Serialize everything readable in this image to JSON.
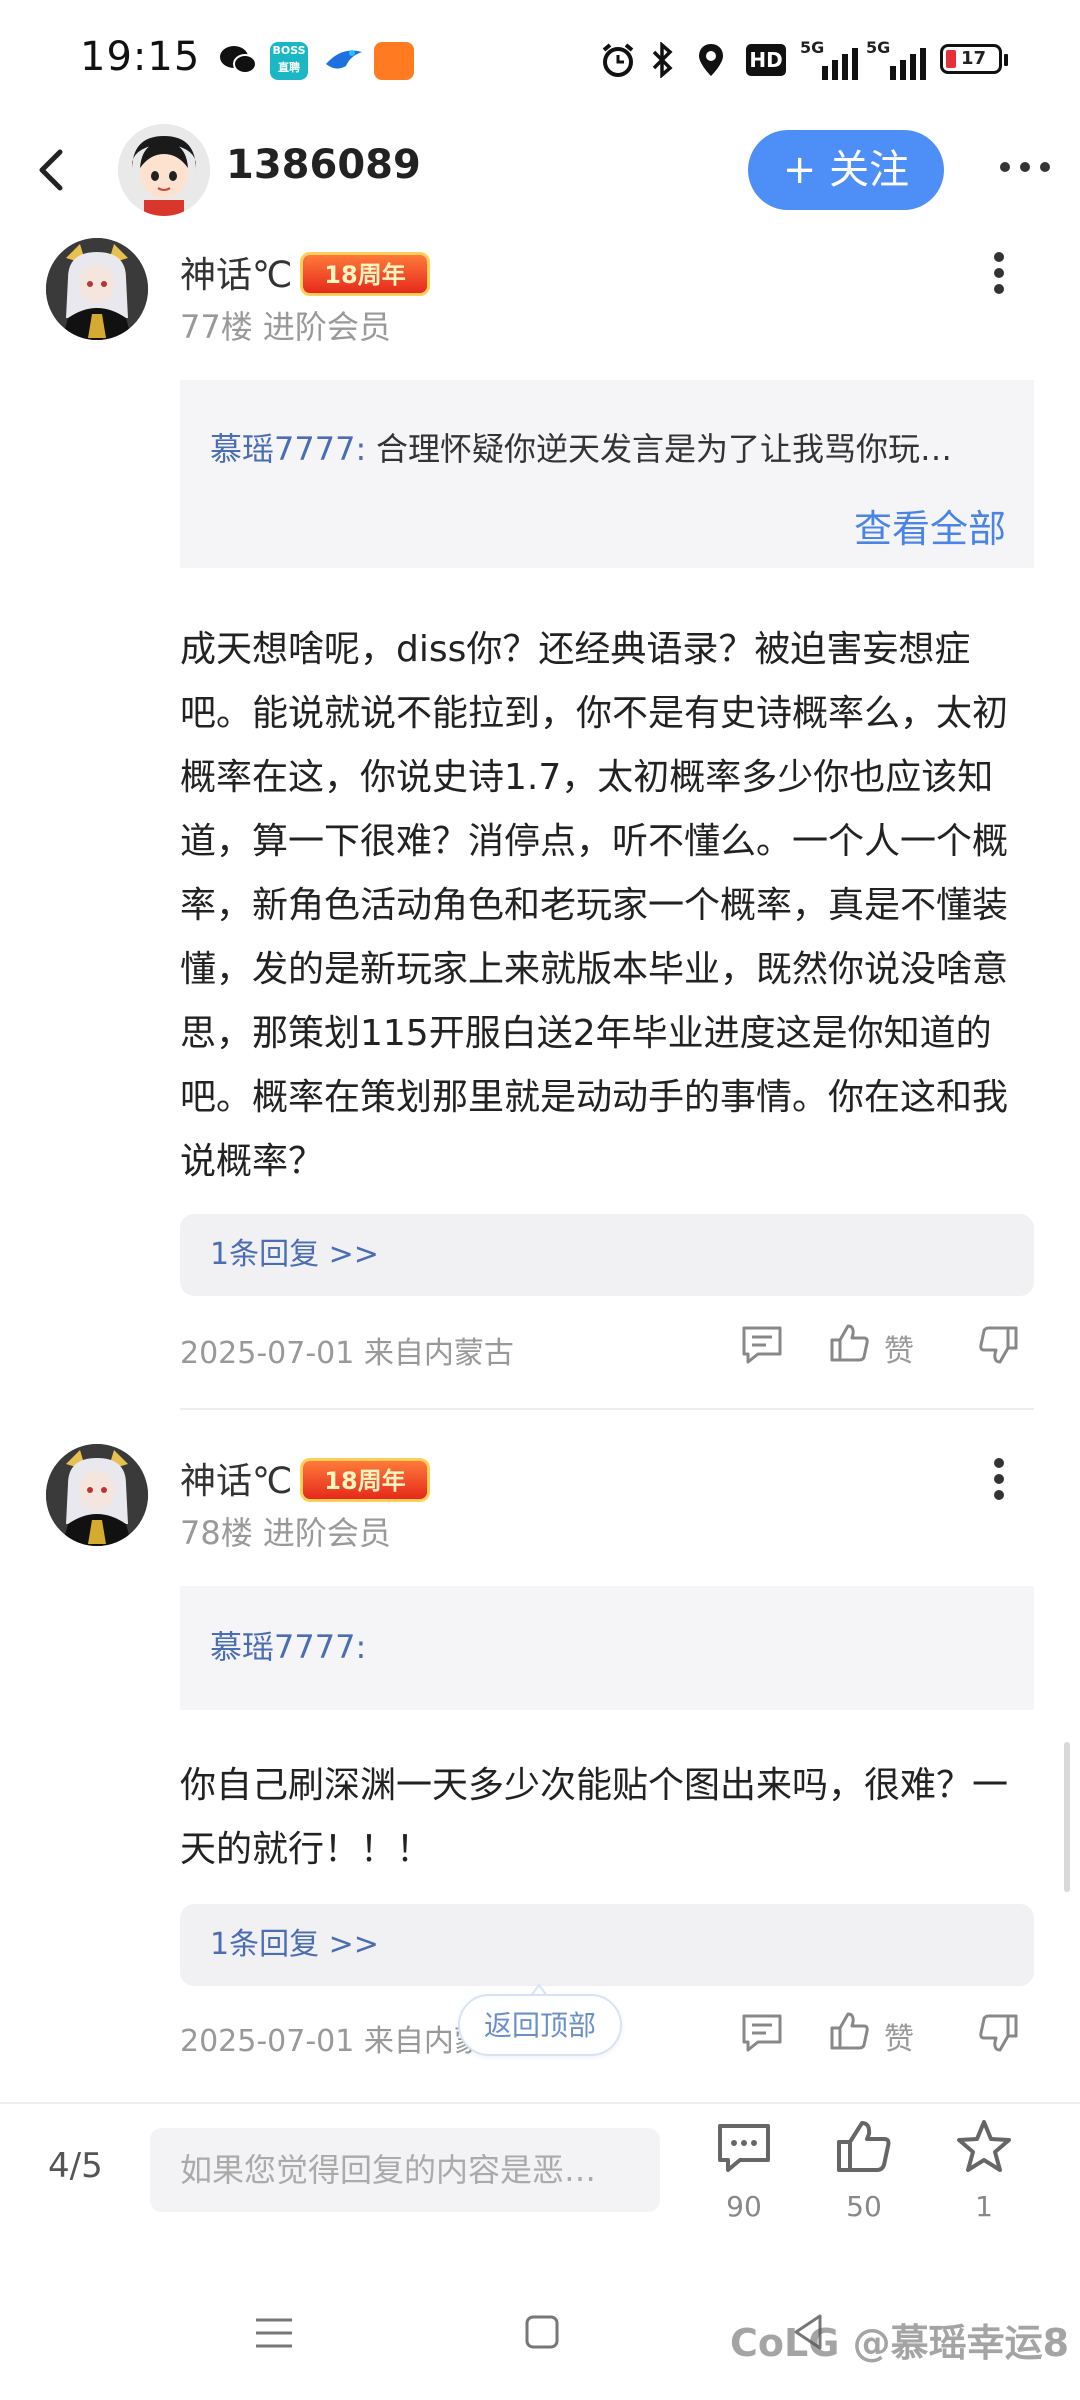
{
  "status_bar": {
    "time": "19:15",
    "battery": "17",
    "app_icons": [
      "chat-bubble-icon",
      "boss-app-icon",
      "bird-app-icon",
      "orange-app-icon"
    ],
    "system_icons": [
      "alarm-icon",
      "bluetooth-icon",
      "location-icon",
      "hd-icon",
      "signal-5g-icon",
      "signal-5g-icon",
      "battery-icon"
    ],
    "hd_label": "HD",
    "net_label": "5G"
  },
  "header": {
    "name": "1386089",
    "follow_label": "+ 关注"
  },
  "posts": [
    {
      "username": "神话℃",
      "badge": "18周年",
      "floor_info": "77楼 进阶会员",
      "quote": {
        "author": "慕瑶7777:",
        "text": "合理怀疑你逆天发言是为了让我骂你玩…",
        "view_all": "查看全部"
      },
      "body": "成天想啥呢，diss你？还经典语录？被迫害妄想症吧。能说就说不能拉到，你不是有史诗概率么，太初概率在这，你说史诗1.7，太初概率多少你也应该知道，算一下很难？消停点，听不懂么。一个人一个概率，新角色活动角色和老玩家一个概率，真是不懂装懂，发的是新玩家上来就版本毕业，既然你说没啥意思，那策划115开服白送2年毕业进度这是你知道的吧。概率在策划那里就是动动手的事情。你在这和我说概率？",
      "replies": "1条回复 >>",
      "meta": "2025-07-01 来自内蒙古",
      "like_label": "赞"
    },
    {
      "username": "神话℃",
      "badge": "18周年",
      "floor_info": "78楼 进阶会员",
      "quote": {
        "author": "慕瑶7777:"
      },
      "body": "你自己刷深渊一天多少次能贴个图出来吗，很难？一天的就行！！！",
      "replies": "1条回复 >>",
      "meta": "2025-07-01 来自内蒙",
      "like_label": "赞"
    }
  ],
  "back_to_top": "返回顶部",
  "bottom_bar": {
    "page": "4/5",
    "input_placeholder": "如果您觉得回复的内容是恶…",
    "comment_count": "90",
    "like_count": "50",
    "star_count": "1"
  },
  "watermark": "CoLG @慕瑶幸运8"
}
